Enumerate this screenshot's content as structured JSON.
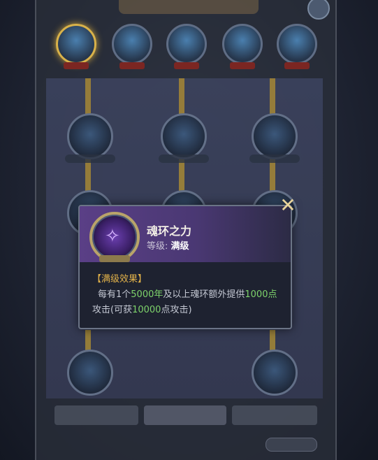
{
  "popup": {
    "skill_name": "魂环之力",
    "level_label": "等级:",
    "level_value": "满级",
    "effect_title": "【满级效果】",
    "effect_parts": {
      "p1": "每有1个",
      "p2": "5000年",
      "p3": "及以上魂环额外提供",
      "p4": "1000点",
      "p5": "攻击(可获",
      "p6": "10000",
      "p7": "点攻击)"
    },
    "close_icon": "close-icon"
  },
  "colors": {
    "accent_gold": "#e2b24a",
    "highlight_green": "#7ed36b",
    "header_purple": "#5a3f86"
  }
}
